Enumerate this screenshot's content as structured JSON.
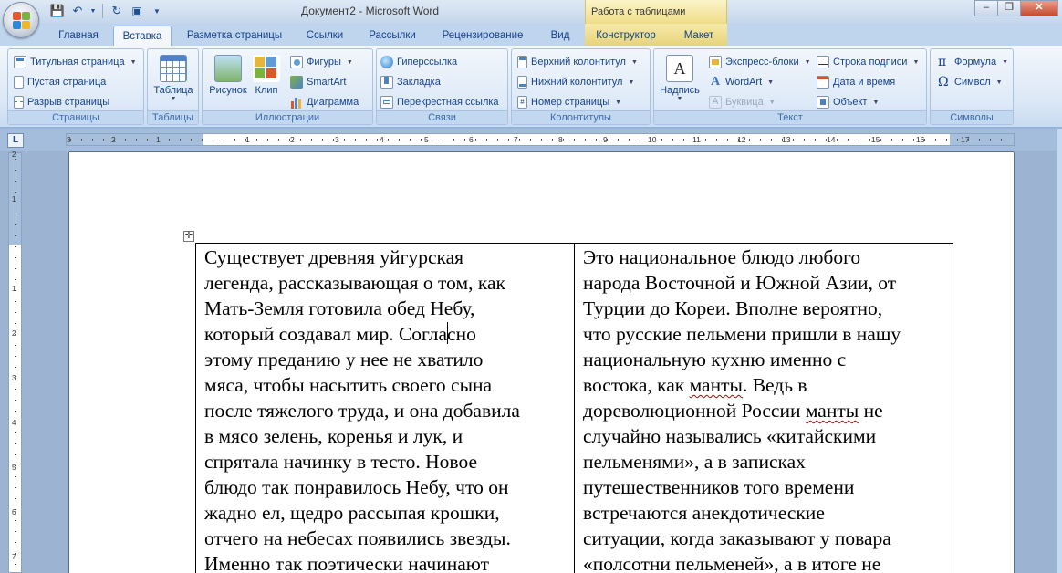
{
  "window": {
    "title": "Документ2 - Microsoft Word",
    "context_tab_title": "Работа с таблицами"
  },
  "tabs": [
    "Главная",
    "Вставка",
    "Разметка страницы",
    "Ссылки",
    "Рассылки",
    "Рецензирование",
    "Вид",
    "Конструктор",
    "Макет"
  ],
  "active_tab": "Вставка",
  "ribbon": {
    "pages": {
      "label": "Страницы",
      "cover": "Титульная страница",
      "blank": "Пустая страница",
      "break": "Разрыв страницы"
    },
    "tables": {
      "label": "Таблицы",
      "table": "Таблица"
    },
    "illustrations": {
      "label": "Иллюстрации",
      "picture": "Рисунок",
      "clip": "Клип",
      "shapes": "Фигуры",
      "smartart": "SmartArt",
      "chart": "Диаграмма"
    },
    "links": {
      "label": "Связи",
      "hyperlink": "Гиперссылка",
      "bookmark": "Закладка",
      "crossref": "Перекрестная ссылка"
    },
    "headerfooter": {
      "label": "Колонтитулы",
      "header": "Верхний колонтитул",
      "footer": "Нижний колонтитул",
      "pagenum": "Номер страницы"
    },
    "text": {
      "label": "Текст",
      "textbox": "Надпись",
      "quickparts": "Экспресс-блоки",
      "wordart": "WordArt",
      "dropcap": "Буквица",
      "sigline": "Строка подписи",
      "datetime": "Дата и время",
      "object": "Объект"
    },
    "symbols": {
      "label": "Символы",
      "equation": "Формула",
      "symbol": "Символ"
    }
  },
  "ruler": {
    "h_ticks": [
      "3",
      "2",
      "1",
      "1",
      "2",
      "3",
      "4",
      "5",
      "6",
      "7",
      "8",
      "9",
      "10",
      "11",
      "12",
      "13",
      "14",
      "15",
      "16",
      "17"
    ],
    "v_ticks": [
      "2",
      "1",
      "1",
      "2",
      "3",
      "4",
      "5",
      "6",
      "7"
    ]
  },
  "document": {
    "col1_lines": [
      "Существует древняя  уйгурская",
      "легенда, рассказывающая о том, как",
      "Мать-Земля готовила обед Небу,",
      "который создавал мир. Согласно",
      "этому преданию у нее не хватило",
      "мяса, чтобы насытить своего сына",
      "после тяжелого труда, и она добавила",
      "в мясо зелень, коренья и лук, и",
      "спрятала начинку в тесто. Новое",
      "блюдо так понравилось Небу, что он",
      "жадно ел, щедро рассыпая крошки,",
      "отчего на небесах появились звезды.",
      "Именно так поэтически начинают"
    ],
    "col2_lines": [
      "Это национальное блюдо любого",
      "народа Восточной и Южной Азии, от",
      "Турции до Кореи. Вполне вероятно,",
      "что русские пельмени пришли в нашу",
      "национальную кухню именно с",
      "востока, как манты. Ведь в",
      "дореволюционной России манты не",
      "случайно назывались «китайскими",
      "пельменями», а в записках",
      "путешественников того времени",
      "встречаются анекдотические",
      "ситуации, когда заказывают у повара",
      "«полсотни пельменей», а в итоге не"
    ]
  }
}
